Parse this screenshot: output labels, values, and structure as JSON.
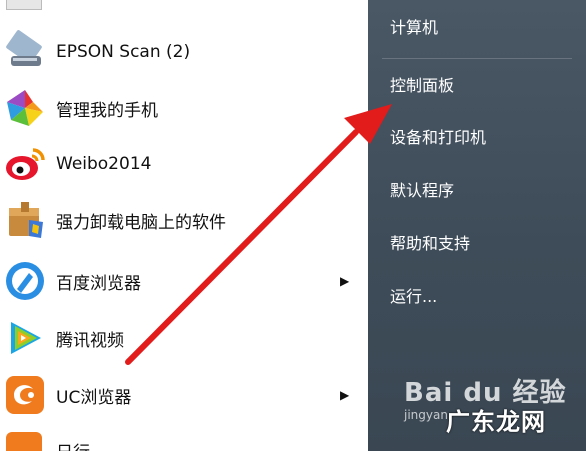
{
  "colors": {
    "right_pane": "#3e4c59",
    "arrow": "#e21b1b"
  },
  "start_menu": {
    "programs": [
      {
        "label": "EPSON Scan (2)",
        "icon": "epson-scan-icon",
        "has_submenu": false
      },
      {
        "label": "管理我的手机",
        "icon": "phone-manager-icon",
        "has_submenu": false
      },
      {
        "label": "Weibo2014",
        "icon": "weibo-icon",
        "has_submenu": false
      },
      {
        "label": "强力卸载电脑上的软件",
        "icon": "uninstaller-icon",
        "has_submenu": false
      },
      {
        "label": "百度浏览器",
        "icon": "baidu-browser-icon",
        "has_submenu": true
      },
      {
        "label": "腾讯视频",
        "icon": "tencent-video-icon",
        "has_submenu": false
      },
      {
        "label": "UC浏览器",
        "icon": "uc-browser-icon",
        "has_submenu": true
      }
    ],
    "bottom_partial_label": "日行",
    "right_items": [
      {
        "label": "计算机"
      },
      {
        "label": "控制面板"
      },
      {
        "label": "设备和打印机"
      },
      {
        "label": "默认程序"
      },
      {
        "label": "帮助和支持"
      },
      {
        "label": "运行..."
      }
    ]
  },
  "watermarks": {
    "baidu": "Bai du 经验",
    "jingyan": "jingyan",
    "site": "广东龙网"
  }
}
